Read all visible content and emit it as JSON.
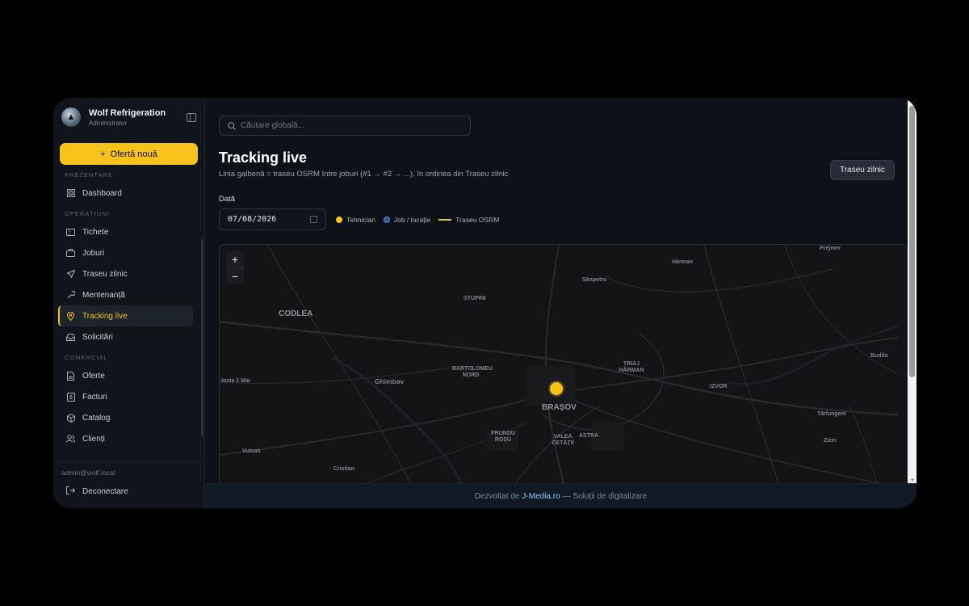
{
  "app": {
    "name": "Wolf Refrigeration",
    "role": "Administrator"
  },
  "sidebar": {
    "new_offer_label": "Ofertă nouă",
    "sections": [
      {
        "title": "PREZENTARE",
        "items": [
          {
            "label": "Dashboard",
            "icon": "grid-icon"
          }
        ]
      },
      {
        "title": "OPERAȚIUNI",
        "items": [
          {
            "label": "Tichete",
            "icon": "ticket-icon"
          },
          {
            "label": "Joburi",
            "icon": "briefcase-icon"
          },
          {
            "label": "Traseu zilnic",
            "icon": "send-icon"
          },
          {
            "label": "Mentenanță",
            "icon": "wrench-icon"
          },
          {
            "label": "Tracking live",
            "icon": "map-pin-icon",
            "active": true
          },
          {
            "label": "Solicitări",
            "icon": "inbox-icon"
          }
        ]
      },
      {
        "title": "COMERCIAL",
        "items": [
          {
            "label": "Oferte",
            "icon": "file-icon"
          },
          {
            "label": "Facturi",
            "icon": "invoice-icon"
          },
          {
            "label": "Catalog",
            "icon": "box-icon"
          },
          {
            "label": "Clienți",
            "icon": "users-icon"
          }
        ]
      }
    ],
    "user_email": "admin@wolf.local",
    "logout_label": "Deconectare"
  },
  "header": {
    "search_placeholder": "Căutare globală..."
  },
  "page": {
    "title": "Tracking live",
    "subtitle": "Linia galbenă = traseu OSRM între joburi (#1 → #2 → ...), în ordinea din Traseu zilnic",
    "route_button": "Traseu zilnic",
    "date_label": "Dată",
    "date_value": "07/08/2026"
  },
  "legend": {
    "technician": "Tehnician",
    "job": "Job / locație",
    "route": "Traseu OSRM",
    "colors": {
      "technician": "#f7c21a",
      "job": "#3b82c4",
      "route": "#f7c21a"
    }
  },
  "map": {
    "zoom_in": "+",
    "zoom_out": "−",
    "places": [
      "CODLEA",
      "Ghimbav",
      "BRAȘOV",
      "STUPINI",
      "BARTOLOMEU NORD",
      "TRIAJ HĂRMAN",
      "Sânpetru",
      "Hărman",
      "IZVOR",
      "Prejmer",
      "Budila",
      "Tărlungeni",
      "Zizin",
      "Vulcan",
      "Cristian",
      "PRUNDU ROȘU",
      "VALEA CETĂȚII",
      "ASTRA",
      "Ionia 1 Mai"
    ]
  },
  "footer": {
    "prefix": "Dezvoltat de",
    "link": "J-Media.ro",
    "suffix": "— Soluții de digitalizare"
  }
}
